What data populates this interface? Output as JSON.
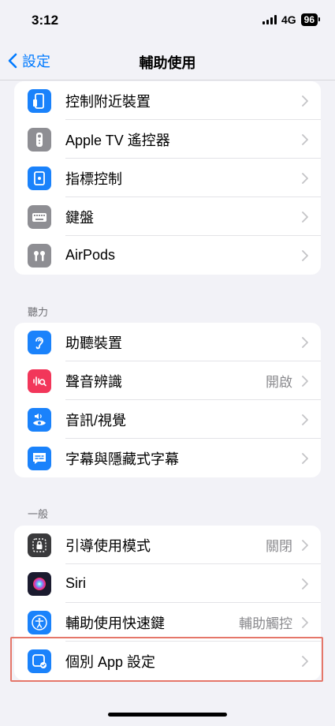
{
  "status_bar": {
    "time": "3:12",
    "network": "4G",
    "battery": "96"
  },
  "nav": {
    "back_label": "設定",
    "title": "輔助使用"
  },
  "groups": {
    "physical": {
      "items": [
        {
          "label": "控制附近裝置",
          "icon": "phone-remote-icon",
          "color": "#1a82fb"
        },
        {
          "label": "Apple TV 遙控器",
          "icon": "tv-remote-icon",
          "color": "#8e8e93"
        },
        {
          "label": "指標控制",
          "icon": "pointer-icon",
          "color": "#1a82fb"
        },
        {
          "label": "鍵盤",
          "icon": "keyboard-icon",
          "color": "#8e8e93"
        },
        {
          "label": "AirPods",
          "icon": "airpods-icon",
          "color": "#8e8e93"
        }
      ]
    },
    "hearing": {
      "header": "聽力",
      "items": [
        {
          "label": "助聽裝置",
          "icon": "ear-icon",
          "color": "#1a82fb"
        },
        {
          "label": "聲音辨識",
          "value": "開啟",
          "icon": "sound-recognition-icon",
          "color": "#f2365a"
        },
        {
          "label": "音訊/視覺",
          "icon": "audio-visual-icon",
          "color": "#1a82fb"
        },
        {
          "label": "字幕與隱藏式字幕",
          "icon": "subtitles-icon",
          "color": "#1a82fb"
        }
      ]
    },
    "general": {
      "header": "一般",
      "items": [
        {
          "label": "引導使用模式",
          "value": "關閉",
          "icon": "lock-frame-icon",
          "color": "#3a3a3c"
        },
        {
          "label": "Siri",
          "icon": "siri-icon",
          "color": "#1b1b2f"
        },
        {
          "label": "輔助使用快速鍵",
          "value": "輔助觸控",
          "icon": "accessibility-icon",
          "color": "#1a82fb"
        },
        {
          "label": "個別 App 設定",
          "icon": "per-app-settings-icon",
          "color": "#1a82fb"
        }
      ]
    }
  },
  "accent": "#007aff",
  "highlight_color": "#e5776a"
}
